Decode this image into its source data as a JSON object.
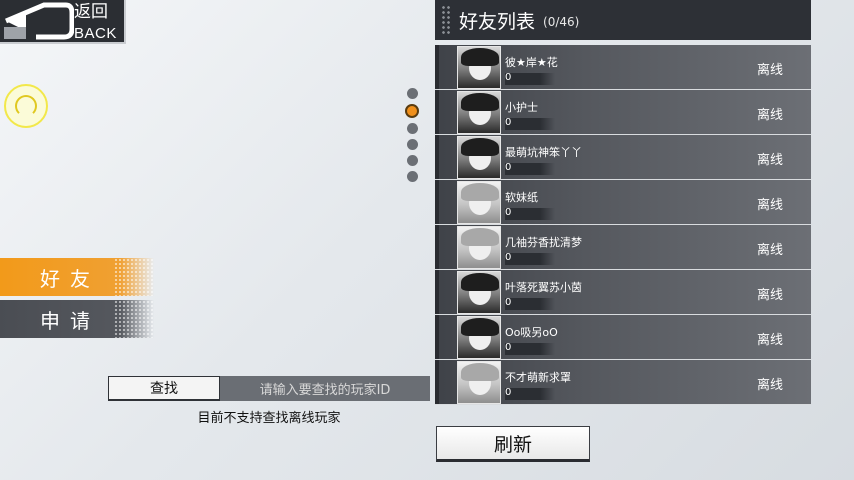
{
  "nav": {
    "back_cn": "返回",
    "back_en": "BACK"
  },
  "tabs": {
    "friends": "好友",
    "apply": "申请"
  },
  "search": {
    "button_label": "查找",
    "placeholder": "请输入要查找的玩家ID",
    "note": "目前不支持查找离线玩家"
  },
  "panel": {
    "title": "好友列表",
    "count": "(0/46)"
  },
  "friends": [
    {
      "name": "彼★岸★花",
      "level": "0",
      "status": "离线"
    },
    {
      "name": "小护士",
      "level": "0",
      "status": "离线"
    },
    {
      "name": "最萌坑神笨丫丫",
      "level": "0",
      "status": "离线"
    },
    {
      "name": "软妹纸",
      "level": "0",
      "status": "离线"
    },
    {
      "name": "几袖芬香扰清梦",
      "level": "0",
      "status": "离线"
    },
    {
      "name": "叶落死翼苏小茵",
      "level": "0",
      "status": "离线"
    },
    {
      "name": "Oo吸另oO",
      "level": "0",
      "status": "离线"
    },
    {
      "name": "不才萌新求罩",
      "level": "0",
      "status": "离线"
    }
  ],
  "refresh_label": "刷新",
  "colors": {
    "accent": "#f29a1a",
    "panel": "#2d3036",
    "row": "#55585e"
  }
}
